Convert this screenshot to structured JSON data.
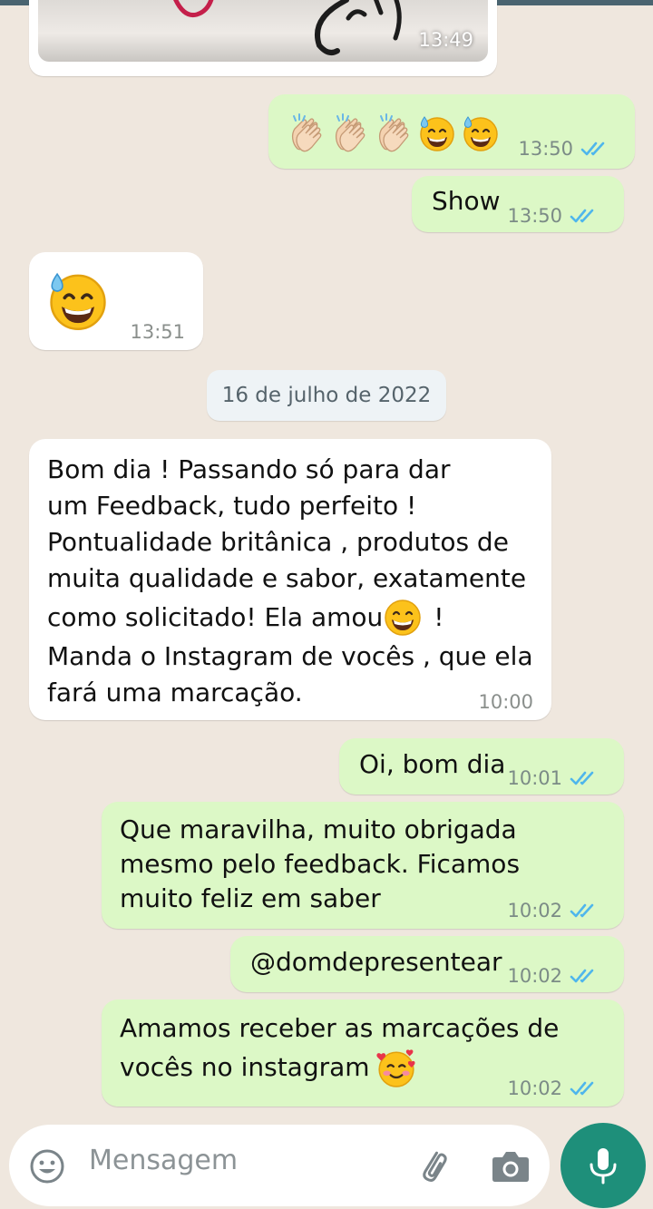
{
  "top_image": {
    "time": "13:49"
  },
  "messages": [
    {
      "id": "m1",
      "direction": "outgoing",
      "emoji": [
        "clapping-hands",
        "clapping-hands",
        "clapping-hands",
        "grinning-sweat",
        "grinning-sweat"
      ],
      "time": "13:50",
      "status": "read"
    },
    {
      "id": "m2",
      "direction": "outgoing",
      "text": "Show",
      "time": "13:50",
      "status": "read"
    },
    {
      "id": "m3",
      "direction": "incoming",
      "emoji": [
        "grinning-sweat"
      ],
      "time": "13:51"
    },
    {
      "id": "m4",
      "direction": "incoming",
      "lines": [
        "Bom dia ! Passando só para dar",
        "um Feedback, tudo perfeito !",
        "Pontualidade britânica , produtos de",
        "muita qualidade e sabor, exatamente",
        "como solicitado! Ela amou",
        "!",
        "Manda o Instagram de vocês , que ela",
        "fará uma marcação."
      ],
      "time": "10:00"
    },
    {
      "id": "m5",
      "direction": "outgoing",
      "text": "Oi, bom dia",
      "time": "10:01",
      "status": "read"
    },
    {
      "id": "m6",
      "direction": "outgoing",
      "lines": [
        "Que maravilha, muito obrigada",
        "mesmo pelo feedback. Ficamos",
        "muito feliz em saber"
      ],
      "time": "10:02",
      "status": "read"
    },
    {
      "id": "m7",
      "direction": "outgoing",
      "text": "@domdepresentear",
      "time": "10:02",
      "status": "read"
    },
    {
      "id": "m8",
      "direction": "outgoing",
      "lines": [
        "Amamos receber as marcações de",
        "vocês no instagram"
      ],
      "time": "10:02",
      "status": "read"
    }
  ],
  "date_divider": "16 de julho de 2022",
  "composer": {
    "placeholder": "Mensagem"
  },
  "colors": {
    "outgoing_bubble": "#dcf8c6",
    "incoming_bubble": "#ffffff",
    "read_tick": "#4fb6ec",
    "mic_button": "#1e8f7a",
    "background": "#efe7de"
  }
}
